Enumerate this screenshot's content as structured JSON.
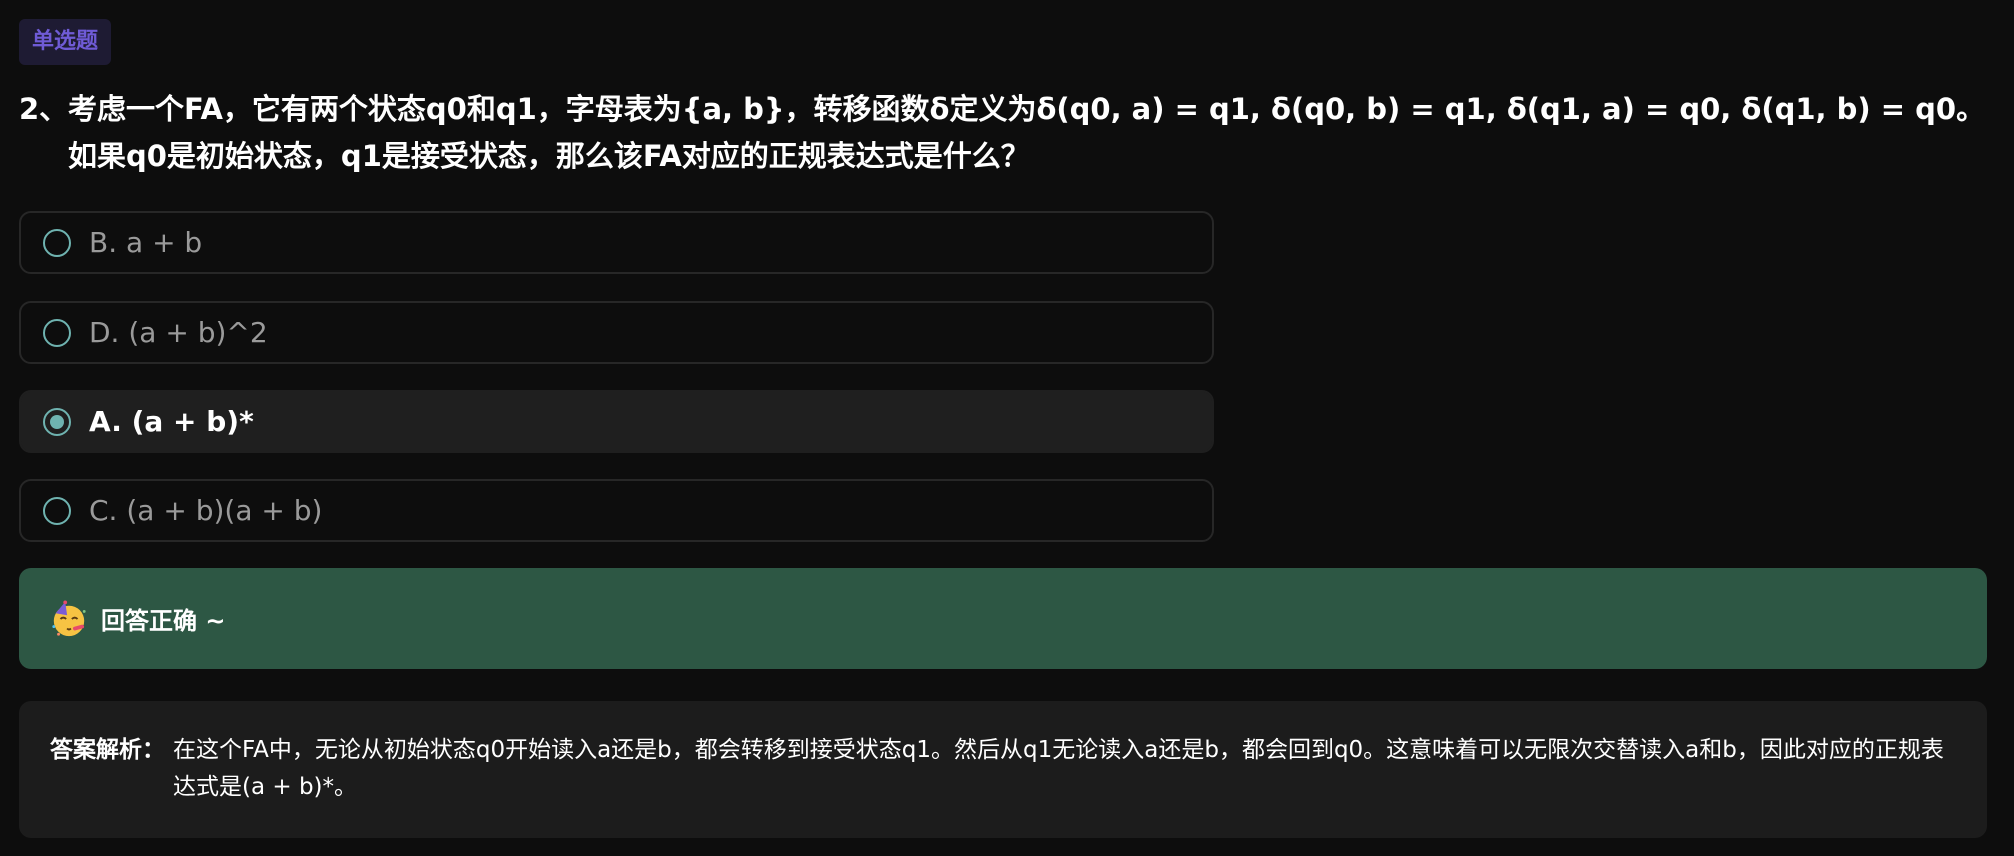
{
  "question": {
    "type_tag": "单选题",
    "number": "2、",
    "text": "考虑一个FA，它有两个状态q0和q1，字母表为{a, b}，转移函数δ定义为δ(q0, a) = q1, δ(q0, b) = q1, δ(q1, a) = q0, δ(q1, b) = q0。如果q0是初始状态，q1是接受状态，那么该FA对应的正规表达式是什么？"
  },
  "options": [
    {
      "label": "B. a + b",
      "selected": false
    },
    {
      "label": "D. (a + b)^2",
      "selected": false
    },
    {
      "label": "A. (a + b)*",
      "selected": true
    },
    {
      "label": "C. (a + b)(a + b)",
      "selected": false
    }
  ],
  "result": {
    "icon": "party-face-emoji",
    "text": "回答正确 ~"
  },
  "analysis": {
    "label": "答案解析：",
    "text": "在这个FA中，无论从初始状态q0开始读入a还是b，都会转移到接受状态q1。然后从q1无论读入a还是b，都会回到q0。这意味着可以无限次交替读入a和b，因此对应的正规表达式是(a + b)*。"
  },
  "colors": {
    "background": "#0d0d0d",
    "tag_text": "#6f5bd6",
    "radio_accent": "#6fb3b0",
    "success_bg": "#2d5744",
    "analysis_bg": "#1c1c1c"
  }
}
